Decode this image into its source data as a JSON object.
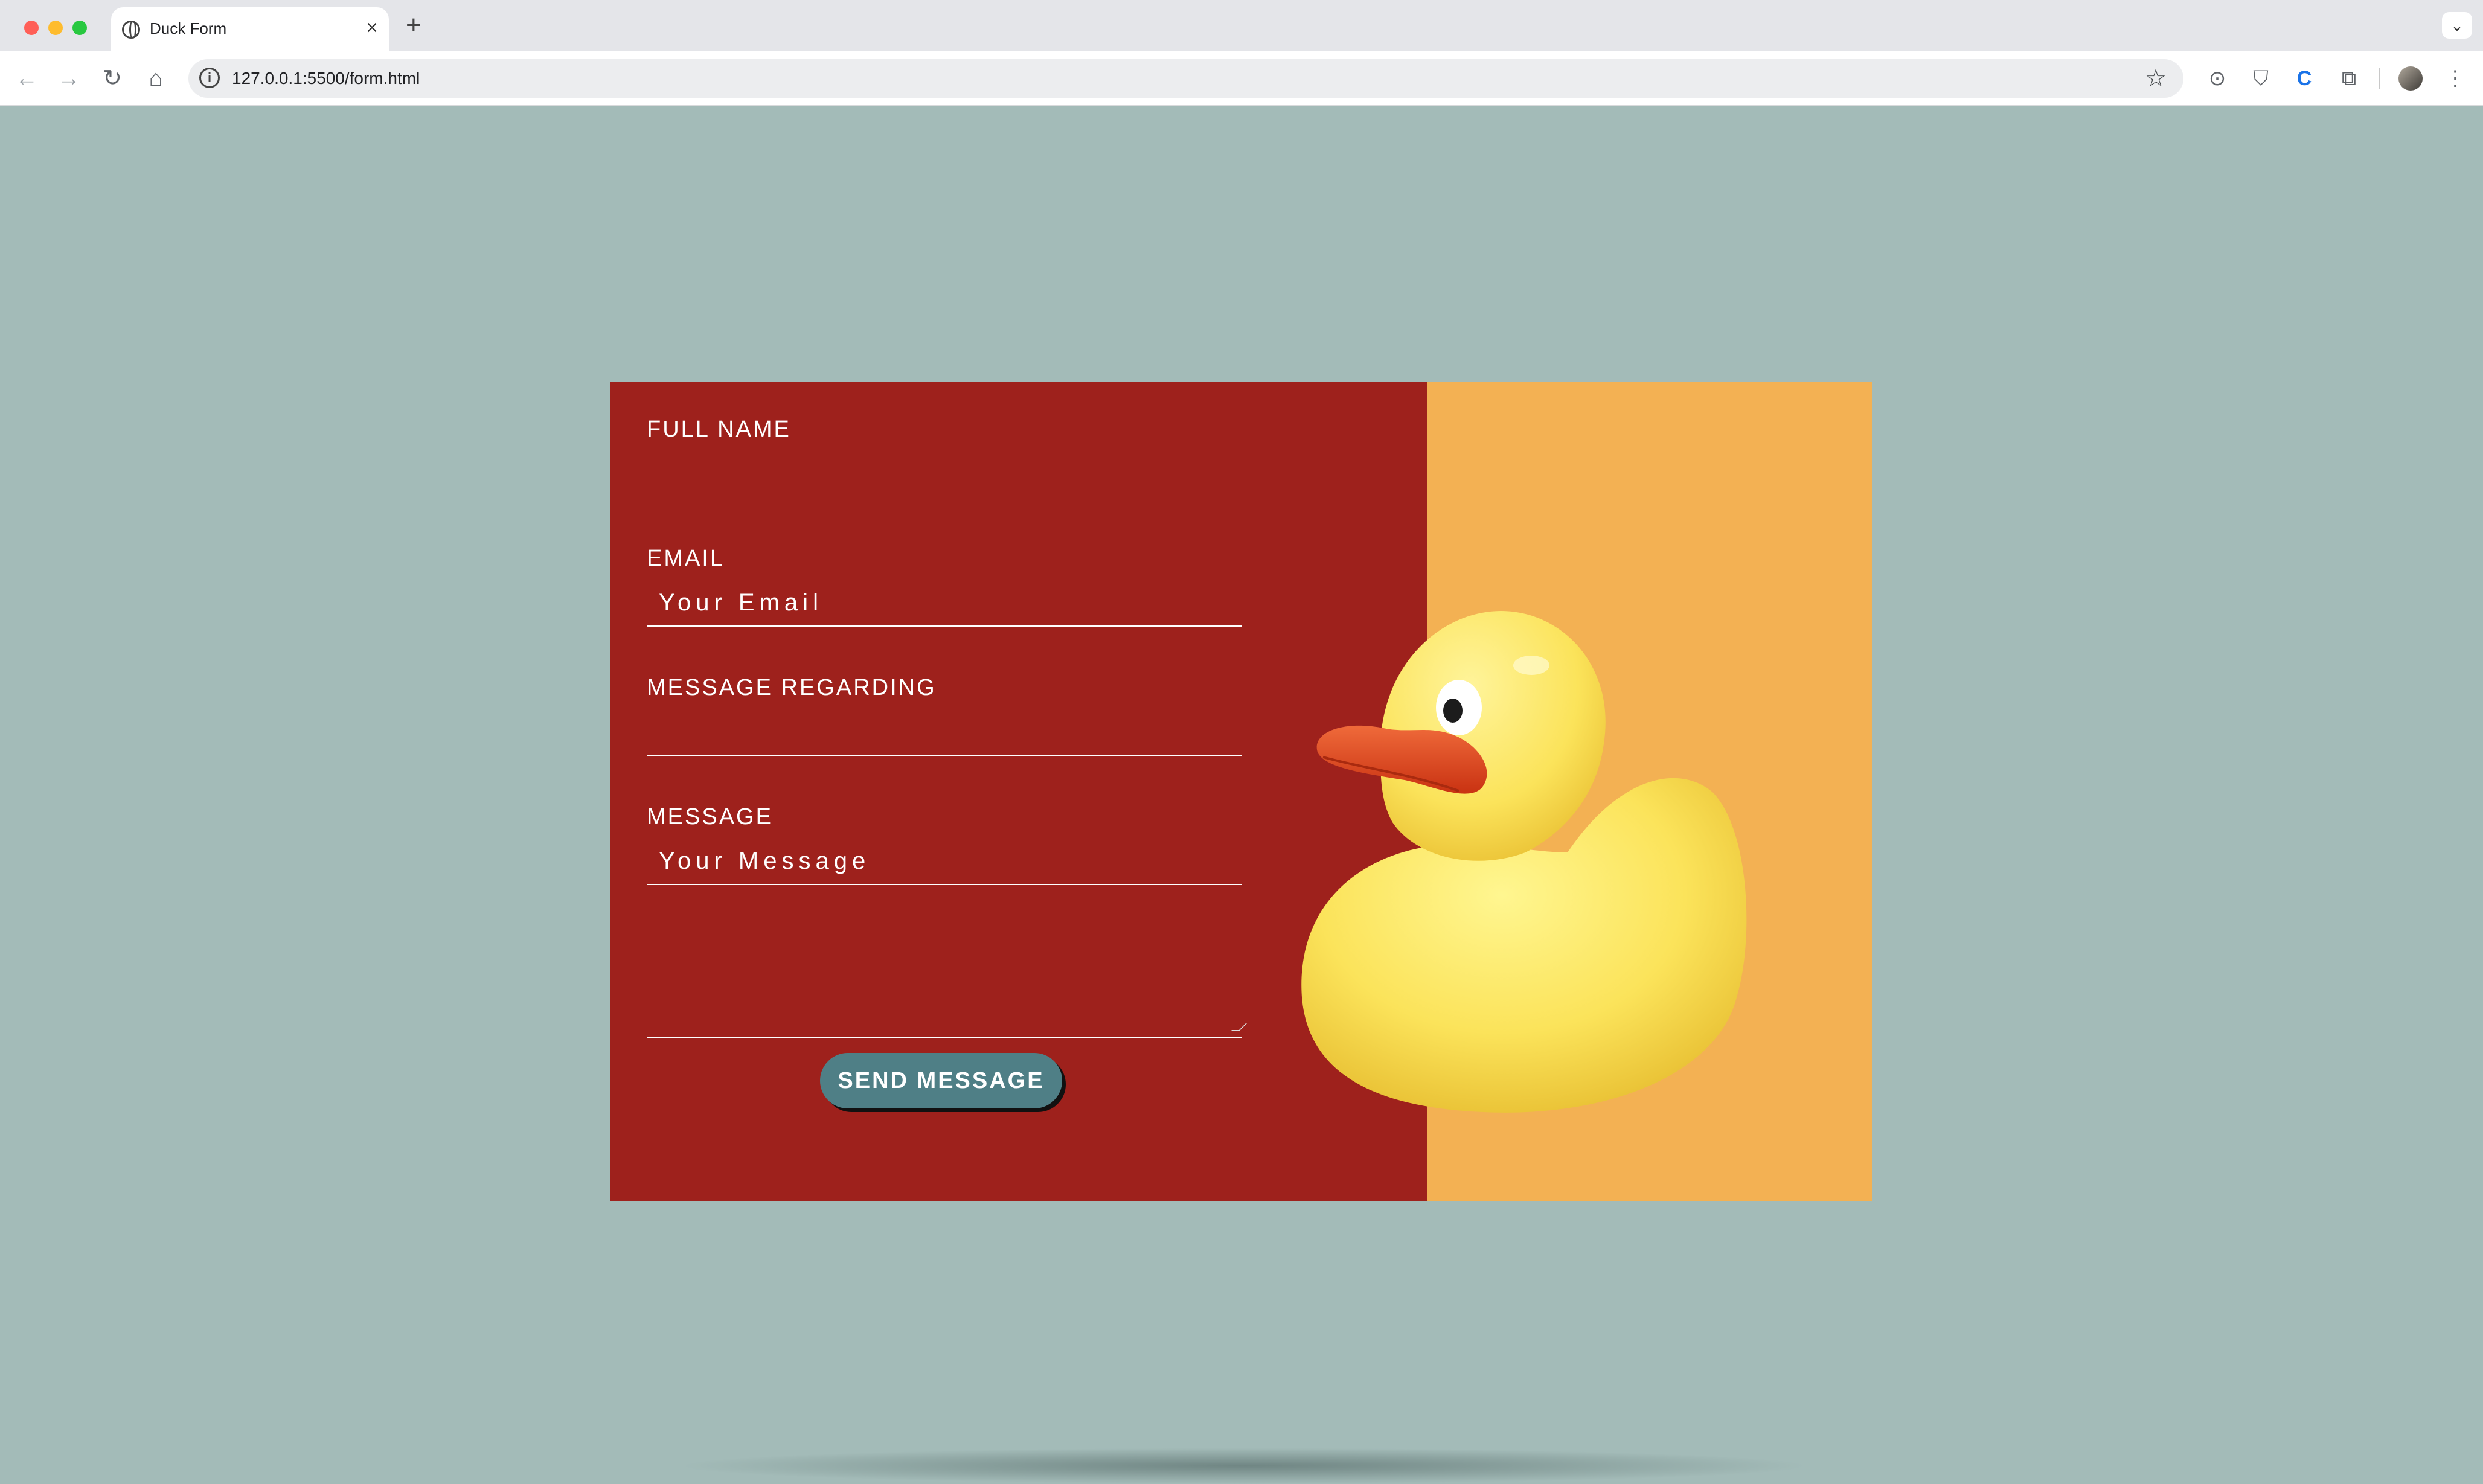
{
  "browser": {
    "tab_title": "Duck Form",
    "url": "127.0.0.1:5500/form.html",
    "tab_close": "×",
    "new_tab": "+",
    "tab_search": "⌄",
    "icons": {
      "back": "←",
      "forward": "→",
      "reload": "↻",
      "home": "⌂",
      "info": "i",
      "star": "☆",
      "camera": "⊙",
      "shield": "⛉",
      "c_ext": "C",
      "extensions": "⧉",
      "menu": "⋮"
    }
  },
  "form": {
    "full_name_label": "FULL NAME",
    "full_name_value": "",
    "email_label": "EMAIL",
    "email_placeholder": "Your Email",
    "regarding_label": "MESSAGE REGARDING",
    "regarding_value": "",
    "message_label": "MESSAGE",
    "message_placeholder": "Your Message",
    "submit_label": "SEND MESSAGE"
  },
  "colors": {
    "page_background": "#a3bbb8",
    "form_panel": "#9e211c",
    "image_background": "#f3b153",
    "button": "#4f7f86",
    "duck_body": "#fbe35a",
    "duck_beak": "#e2481f"
  }
}
